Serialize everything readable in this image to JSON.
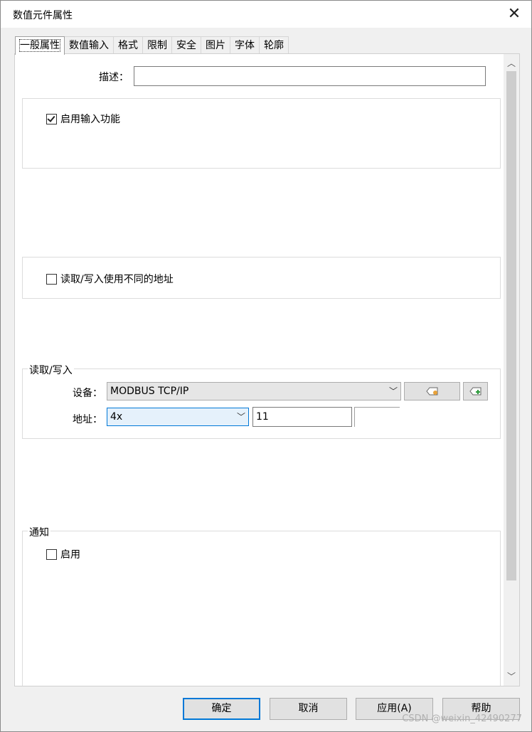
{
  "window": {
    "title": "数值元件属性"
  },
  "tabs": [
    {
      "label": "一般属性",
      "active": true
    },
    {
      "label": "数值输入"
    },
    {
      "label": "格式"
    },
    {
      "label": "限制"
    },
    {
      "label": "安全"
    },
    {
      "label": "图片"
    },
    {
      "label": "字体"
    },
    {
      "label": "轮廓"
    }
  ],
  "description": {
    "label": "描述：",
    "value": ""
  },
  "input_function": {
    "label": "启用输入功能",
    "checked": true
  },
  "diff_address": {
    "label": "读取/写入使用不同的地址",
    "checked": false
  },
  "read_write": {
    "title": "读取/写入",
    "device_label": "设备：",
    "device_value": "MODBUS TCP/IP",
    "address_label": "地址：",
    "address_type": "4x",
    "address_value": "11"
  },
  "notify": {
    "title": "通知",
    "enable_label": "启用",
    "checked": false
  },
  "buttons": {
    "ok": "确定",
    "cancel": "取消",
    "apply": "应用(A)",
    "help": "帮助"
  },
  "watermark": "CSDN @weixin_42490277",
  "icons": [
    "close-icon",
    "tag-read-icon",
    "tag-add-icon",
    "chevron-down-icon",
    "scroll-up-icon",
    "scroll-down-icon"
  ]
}
